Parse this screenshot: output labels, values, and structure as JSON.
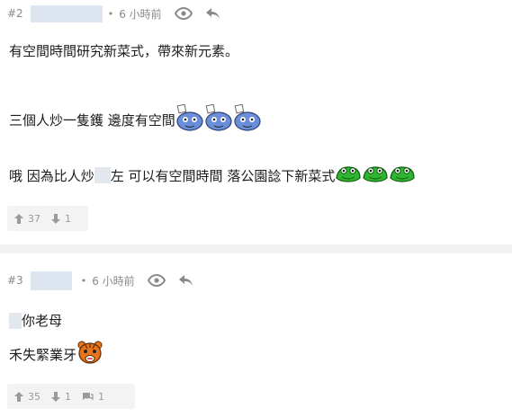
{
  "post1": {
    "floor": "#2",
    "dot": "•",
    "time": "6 小時前",
    "line1": "有空間時間研究新菜式，帶來新元素。",
    "line2": "三個人炒一隻鑊 邊度有空間",
    "line3_a": "哦 因為比人炒",
    "line3_b": "左 可以有空間時間 落公園諗下新菜式",
    "upvotes": "37",
    "downvotes": "1"
  },
  "post2": {
    "floor": "#3",
    "dot": "•",
    "time": "6 小時前",
    "line1": "你老母",
    "line2": "禾失緊業牙",
    "upvotes": "35",
    "downvotes": "1",
    "replies": "1"
  },
  "icons": {
    "eye": "eye-icon",
    "reply": "reply-arrow-icon",
    "up": "thumb-up-arrow-icon",
    "down": "thumb-down-arrow-icon",
    "comment": "comment-bubble-icon"
  },
  "colors": {
    "meta": "#8a8a8a",
    "vote_bg": "#f3f3f3",
    "separator": "#f2f2f2",
    "green_emoji": "#2fb52f",
    "blue_emoji": "#6a8fd8",
    "tiger_emoji": "#e8751a"
  }
}
